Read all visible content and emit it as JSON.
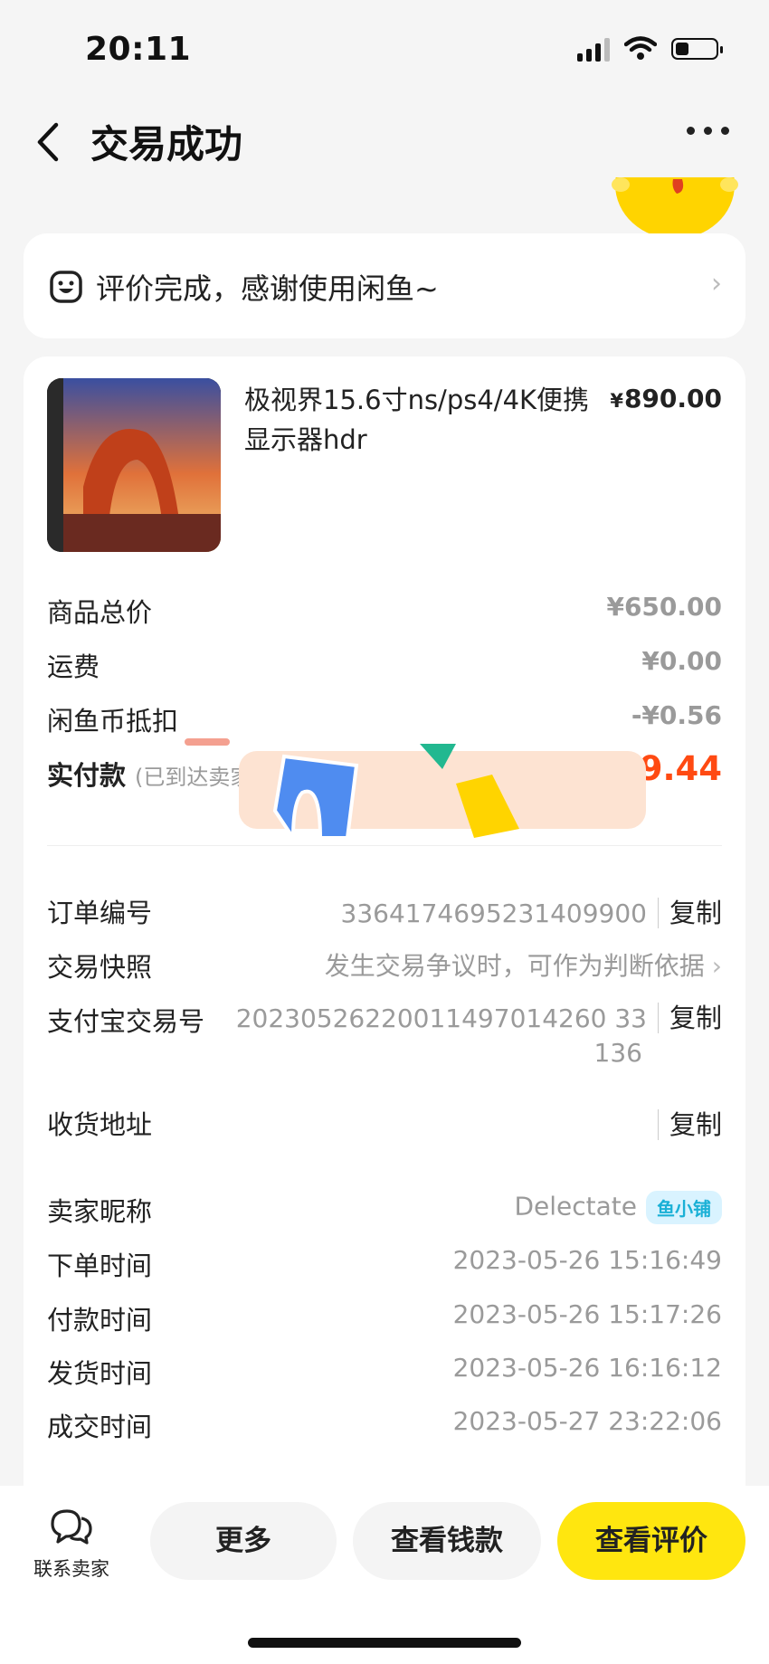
{
  "status": {
    "time": "20:11",
    "battery_level": 0.35
  },
  "nav": {
    "title": "交易成功"
  },
  "review": {
    "text": "评价完成，感谢使用闲鱼~"
  },
  "product": {
    "title": "极视界15.6寸ns/ps4/4K便携显示器hdr",
    "price_currency": "¥",
    "price": "890.00"
  },
  "summary": {
    "goods_total_label": "商品总价",
    "goods_total_value": "¥650.00",
    "shipping_label": "运费",
    "shipping_value": "¥0.00",
    "coin_label": "闲鱼币抵扣",
    "coin_value": "-¥0.56",
    "paid_label": "实付款",
    "paid_note": "(已到达卖家账户)",
    "paid_currency": "¥",
    "paid_value": "649.44"
  },
  "details": {
    "order_no_label": "订单编号",
    "order_no": "3364174695231409900",
    "copy_label": "复制",
    "snapshot_label": "交易快照",
    "snapshot_value": "发生交易争议时，可作为判断依据",
    "alipay_label": "支付宝交易号",
    "alipay_line1": "20230526220011497014260 33",
    "alipay_line2": "136",
    "address_label": "收货地址",
    "seller_label": "卖家昵称",
    "seller_name": "Delectate",
    "seller_badge": "鱼小铺",
    "order_time_label": "下单时间",
    "order_time": "2023-05-26 15:16:49",
    "pay_time_label": "付款时间",
    "pay_time": "2023-05-26 15:17:26",
    "ship_time_label": "发货时间",
    "ship_time": "2023-05-26 16:16:12",
    "deal_time_label": "成交时间",
    "deal_time": "2023-05-27 23:22:06"
  },
  "bottom": {
    "contact_label": "联系卖家",
    "more_label": "更多",
    "money_label": "查看钱款",
    "review_label": "查看评价"
  },
  "colors": {
    "accent_yellow": "#ffe60f",
    "price_orange": "#ff4a12"
  }
}
